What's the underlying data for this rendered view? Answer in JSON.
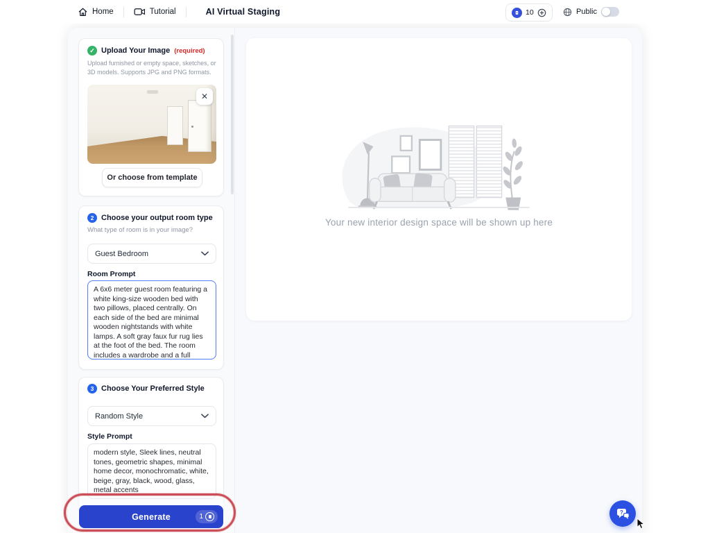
{
  "header": {
    "home_label": "Home",
    "tutorial_label": "Tutorial",
    "app_title": "AI Virtual Staging",
    "credits_count": "10",
    "public_label": "Public",
    "public_toggle_on": false
  },
  "steps": {
    "upload": {
      "title": "Upload Your Image",
      "required": "(required)",
      "description": "Upload furnished or empty space, sketches, or 3D models. Supports JPG and PNG formats.",
      "template_button_label": "Or choose from template"
    },
    "room_type": {
      "number": "2",
      "title": "Choose your output room type",
      "question": "What type of room is in your image?",
      "selected_option": "Guest Bedroom",
      "prompt_label": "Room Prompt",
      "prompt_value": "A 6x6 meter guest room featuring a white king-size wooden bed with two pillows, placed centrally. On each side of the bed are minimal wooden nightstands with white lamps. A soft gray faux fur rug lies at the foot of the bed. The room includes a wardrobe and a full"
    },
    "style": {
      "number": "3",
      "title": "Choose Your Preferred Style",
      "selected_option": "Random Style",
      "prompt_label": "Style Prompt",
      "prompt_value": "modern style, Sleek lines, neutral tones, geometric shapes, minimal home decor, monochromatic, white, beige, gray, black, wood, glass, metal accents"
    }
  },
  "footer": {
    "generate_label": "Generate",
    "generation_cost": "1"
  },
  "preview_panel": {
    "placeholder_text": "Your new interior design space will be shown up here"
  },
  "icons": {
    "close_glyph": "✕",
    "check_glyph": "✓"
  },
  "colors": {
    "accent_blue": "#2a43cd",
    "step_blue": "#2563eb",
    "success_green": "#36b368",
    "required_red": "#dc2626",
    "annotation_red": "#cb4e59"
  }
}
